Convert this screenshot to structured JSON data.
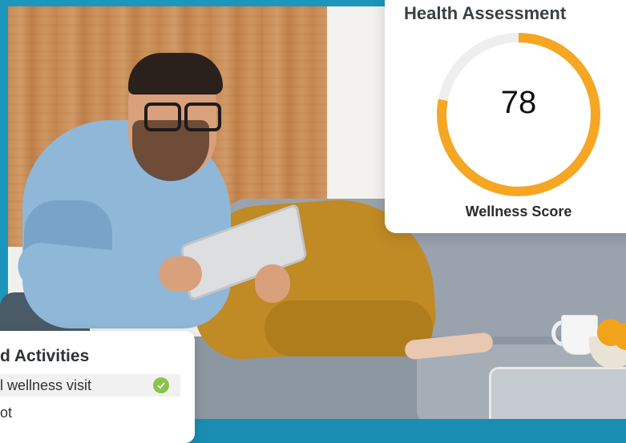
{
  "health_card": {
    "title": "Health Assessment",
    "score": "78",
    "score_fraction": 0.78,
    "score_label": "Wellness Score",
    "colors": {
      "ring_fill": "#f5a623",
      "ring_track": "#eeeeee"
    }
  },
  "activities_card": {
    "title": "d Activities",
    "items": [
      {
        "label": "l wellness visit",
        "completed": true
      },
      {
        "label": "ot",
        "completed": false
      }
    ],
    "colors": {
      "check": "#8bc34a"
    }
  },
  "background": {
    "accent": "#1c96bd"
  }
}
